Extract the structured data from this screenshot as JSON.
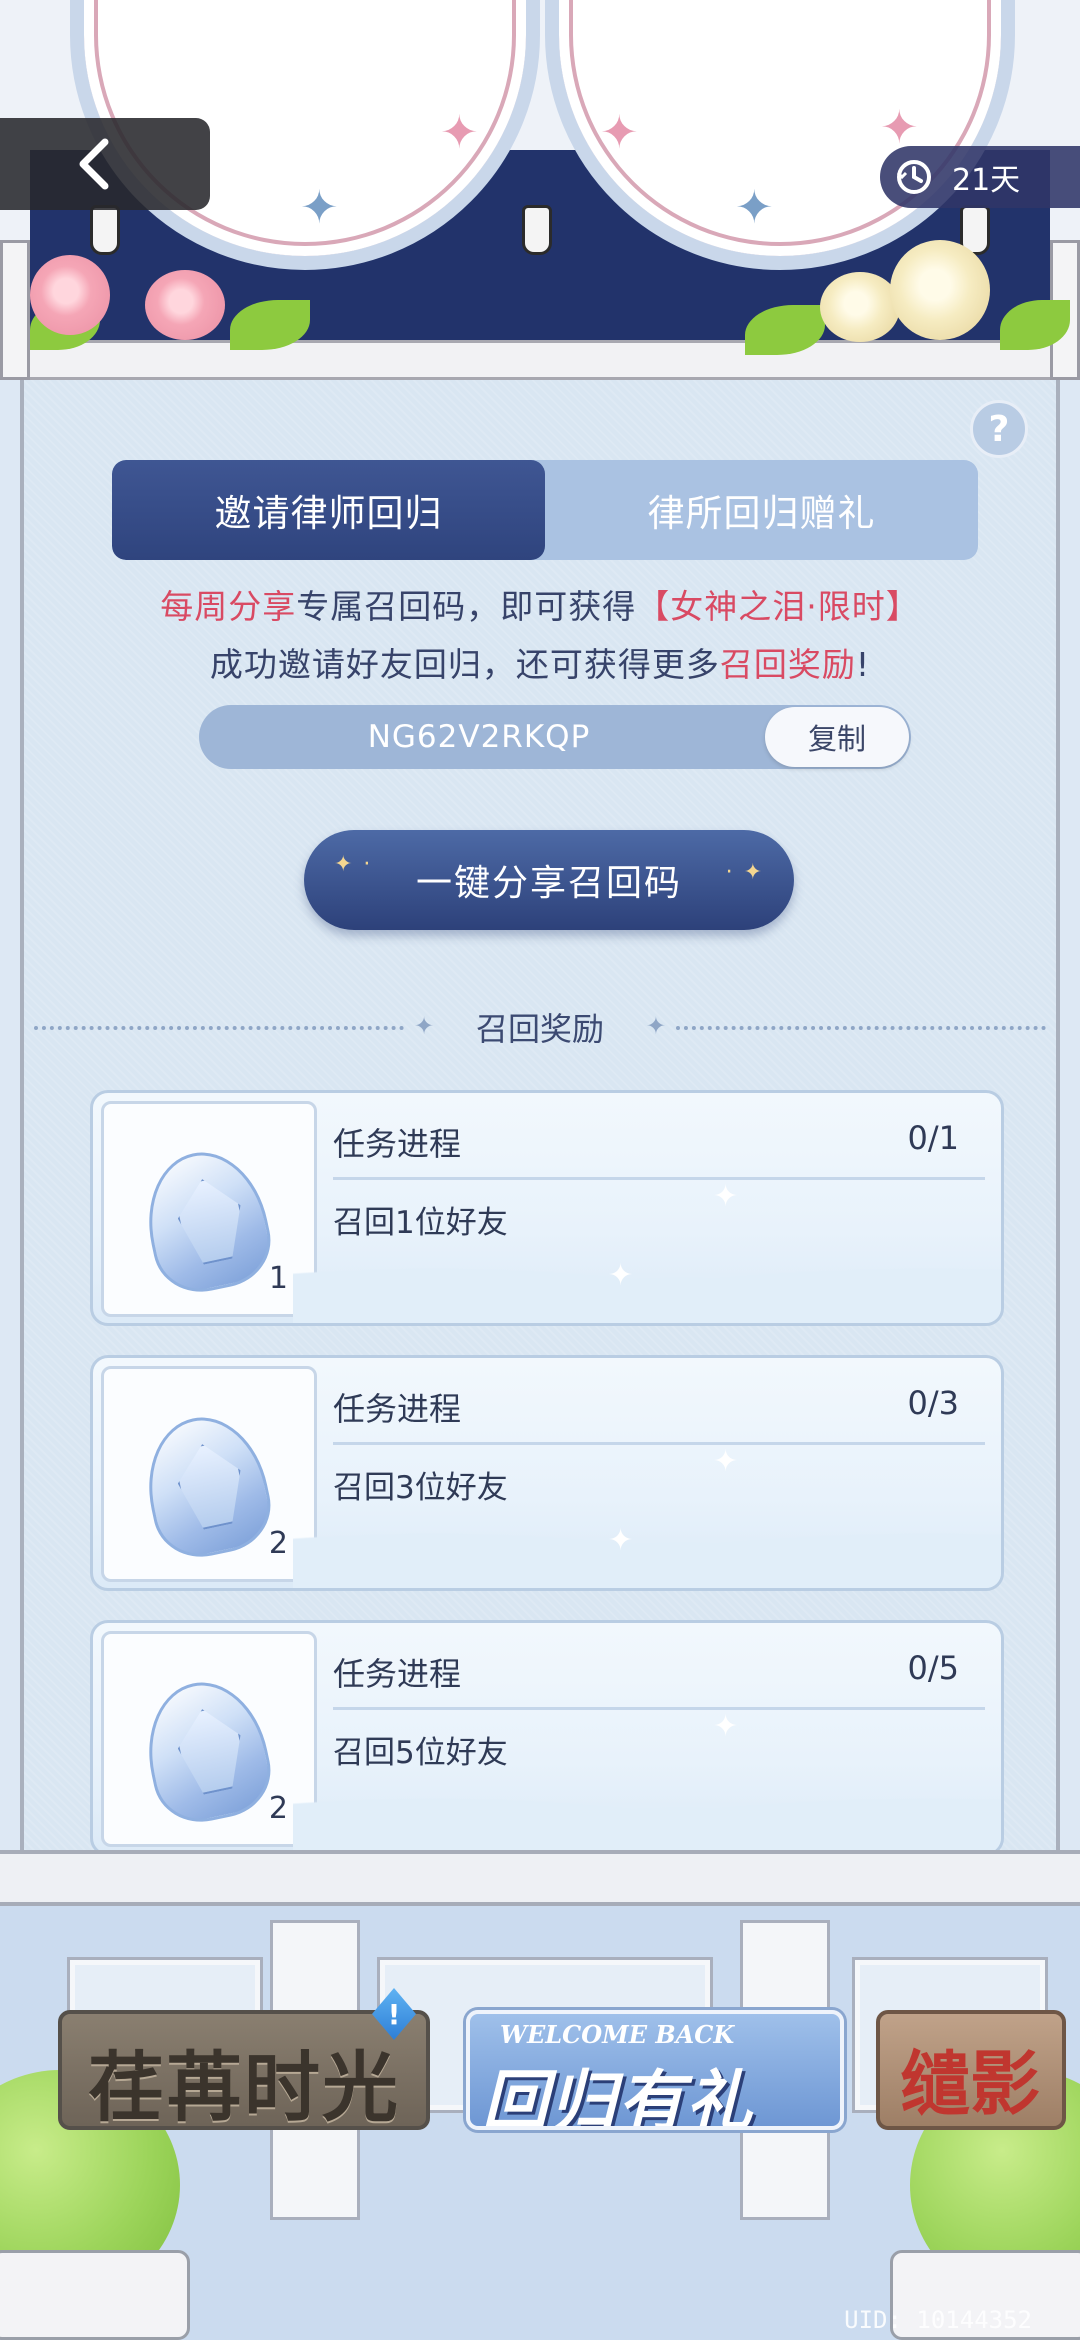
{
  "header": {
    "days": "21天"
  },
  "tabs": [
    {
      "label": "邀请律师回归",
      "active": true
    },
    {
      "label": "律所回归赠礼",
      "active": false
    }
  ],
  "description": {
    "line1_red": "每周分享",
    "line1_mid": "专属召回码，即可获得",
    "line1_reward": "【女神之泪·限时】",
    "line2_start": "成功邀请好友回归，还可获得更多",
    "line2_red": "召回奖励",
    "line2_end": "!"
  },
  "recall_code": {
    "value": "NG62V2RKQP",
    "copy_label": "复制"
  },
  "share_button": "一键分享召回码",
  "section_title": "召回奖励",
  "rewards": [
    {
      "title": "任务进程",
      "progress": "0/1",
      "task": "召回1位好友",
      "quantity": "1",
      "icon": "goddess-tear-crystal-icon"
    },
    {
      "title": "任务进程",
      "progress": "0/3",
      "task": "召回3位好友",
      "quantity": "2",
      "icon": "goddess-tear-crystal-icon"
    },
    {
      "title": "任务进程",
      "progress": "0/5",
      "task": "召回5位好友",
      "quantity": "2",
      "icon": "goddess-tear-crystal-icon"
    }
  ],
  "banners": [
    {
      "label": "荏苒时光"
    },
    {
      "label_small": "WELCOME BACK",
      "label": "回归有礼"
    },
    {
      "label": "缱影"
    }
  ],
  "alert_badge": "!",
  "uid": "UID: 10144352",
  "colors": {
    "accent_navy": "#2f447e",
    "highlight_red": "#d94a63",
    "panel_bg": "#d9e6f2"
  }
}
